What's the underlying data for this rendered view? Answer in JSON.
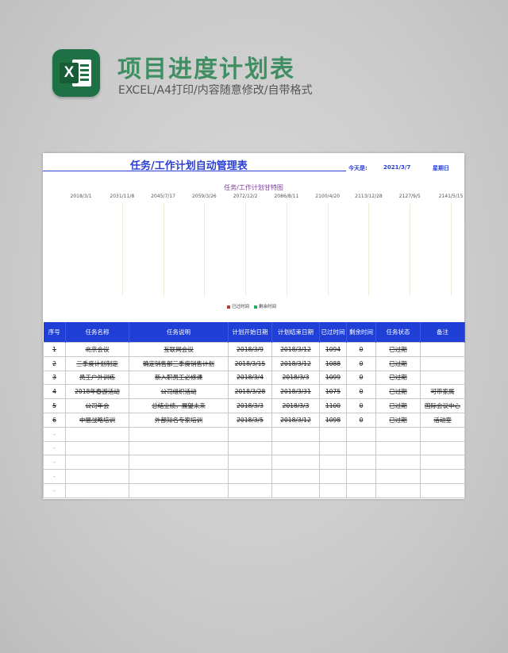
{
  "header": {
    "title": "项目进度计划表",
    "subtitle": "EXCEL/A4打印/内容随意修改/自带格式",
    "logo_letter": "X",
    "logo_icon": "excel-icon"
  },
  "sheet": {
    "title": "任务/工作计划自动管理表",
    "today_label": "今天是:",
    "today_date": "2021/3/7",
    "weekday": "星期日"
  },
  "chart_data": {
    "type": "bar",
    "title": "任务/工作计划甘特图",
    "axis_ticks": [
      "2018/3/1",
      "2031/11/8",
      "2045/7/17",
      "2059/3/26",
      "2072/12/2",
      "2086/8/11",
      "2100/4/20",
      "2113/12/28",
      "2127/9/5",
      "2141/5/15"
    ],
    "series": [
      {
        "name": "已过时间",
        "color": "#c0392b",
        "values": []
      },
      {
        "name": "剩余时间",
        "color": "#27ae60",
        "values": []
      }
    ],
    "grid": true,
    "legend_position": "bottom"
  },
  "table": {
    "columns": [
      "序号",
      "任务名称",
      "任务说明",
      "计划开始日期",
      "计划结束日期",
      "已过时间",
      "剩余时间",
      "任务状态",
      "备注"
    ],
    "rows": [
      [
        "1",
        "北京会议",
        "互联网会议",
        "2018/3/9",
        "2018/3/12",
        "1094",
        "0",
        "已过期",
        ""
      ],
      [
        "2",
        "三季度计划制定",
        "确定销售部三季度销售计划",
        "2018/3/15",
        "2018/3/12",
        "1088",
        "0",
        "已过期",
        ""
      ],
      [
        "3",
        "员工户外训练",
        "新入职员工必修课",
        "2018/3/4",
        "2018/3/3",
        "1099",
        "0",
        "已过期",
        ""
      ],
      [
        "4",
        "2018年春游活动",
        "公司组织活动",
        "2018/3/28",
        "2018/3/31",
        "1075",
        "0",
        "已过期",
        "可带家属"
      ],
      [
        "5",
        "公司年会",
        "总结业绩，展望未来",
        "2018/3/3",
        "2018/3/3",
        "1100",
        "0",
        "已过期",
        "国际会议中心"
      ],
      [
        "6",
        "中层战略培训",
        "外部知名专家培训",
        "2018/3/5",
        "2018/3/12",
        "1098",
        "0",
        "已过期",
        "活动室"
      ],
      [
        "-",
        "",
        "",
        "",
        "",
        "",
        "",
        "",
        ""
      ],
      [
        "-",
        "",
        "",
        "",
        "",
        "",
        "",
        "",
        ""
      ],
      [
        "-",
        "",
        "",
        "",
        "",
        "",
        "",
        "",
        ""
      ],
      [
        "-",
        "",
        "",
        "",
        "",
        "",
        "",
        "",
        ""
      ],
      [
        "-",
        "",
        "",
        "",
        "",
        "",
        "",
        "",
        ""
      ]
    ]
  }
}
